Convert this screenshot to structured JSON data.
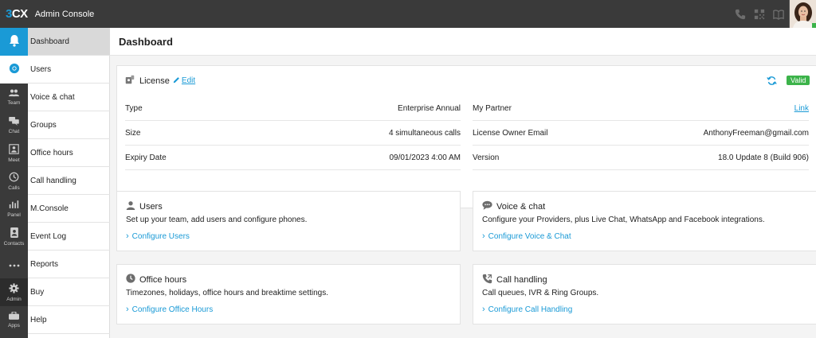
{
  "header": {
    "logo_three": "3",
    "logo_cx": "CX",
    "app_title": "Admin Console",
    "icons": [
      "phone-icon",
      "qr-code-icon",
      "book-icon"
    ]
  },
  "rail": {
    "items": [
      {
        "name": "notifications",
        "icon": "bell-icon",
        "label": ""
      },
      {
        "name": "chrome",
        "icon": "chrome-icon",
        "label": ""
      },
      {
        "name": "team",
        "icon": "team-icon",
        "label": "Team"
      },
      {
        "name": "chat",
        "icon": "chat-icon",
        "label": "Chat"
      },
      {
        "name": "meet",
        "icon": "meet-icon",
        "label": "Meet"
      },
      {
        "name": "calls",
        "icon": "calls-icon",
        "label": "Calls"
      },
      {
        "name": "panel",
        "icon": "panel-icon",
        "label": "Panel"
      },
      {
        "name": "contacts",
        "icon": "contacts-icon",
        "label": "Contacts"
      },
      {
        "name": "more",
        "icon": "more-icon",
        "label": ""
      },
      {
        "name": "admin",
        "icon": "gear-icon",
        "label": "Admin"
      },
      {
        "name": "apps",
        "icon": "apps-icon",
        "label": "Apps"
      }
    ]
  },
  "submenu": {
    "items": [
      {
        "label": "Dashboard",
        "active": true
      },
      {
        "label": "Users"
      },
      {
        "label": "Voice & chat"
      },
      {
        "label": "Groups"
      },
      {
        "label": "Office hours"
      },
      {
        "label": "Call handling"
      },
      {
        "label": "M.Console"
      },
      {
        "label": "Event Log"
      },
      {
        "label": "Reports"
      },
      {
        "label": "Buy"
      },
      {
        "label": "Help"
      }
    ]
  },
  "main": {
    "title": "Dashboard",
    "license": {
      "title": "License",
      "edit_label": "Edit",
      "status": "Valid",
      "status_color": "#3cb34a",
      "left_rows": [
        {
          "label": "Type",
          "value": "Enterprise Annual"
        },
        {
          "label": "Size",
          "value": "4 simultaneous calls"
        },
        {
          "label": "Expiry Date",
          "value": "09/01/2023 4:00 AM"
        }
      ],
      "right_rows": [
        {
          "label": "My Partner",
          "value": "Link"
        },
        {
          "label": "License Owner Email",
          "value": "AnthonyFreeman@gmail.com"
        },
        {
          "label": "Version",
          "value": "18.0 Update 8 (Build 906)"
        }
      ]
    },
    "tiles": [
      {
        "icon": "user-icon",
        "title": "Users",
        "desc": "Set up your team, add users and configure phones.",
        "link": "Configure Users"
      },
      {
        "icon": "chat-bubble-icon",
        "title": "Voice & chat",
        "desc": "Configure your Providers, plus Live Chat, WhatsApp and Facebook integrations.",
        "link": "Configure Voice & Chat"
      },
      {
        "icon": "clock-icon",
        "title": "Office hours",
        "desc": "Timezones, holidays, office hours and breaktime settings.",
        "link": "Configure Office Hours"
      },
      {
        "icon": "call-handling-icon",
        "title": "Call handling",
        "desc": "Call queues, IVR & Ring Groups.",
        "link": "Configure Call Handling"
      }
    ]
  },
  "colors": {
    "accent": "#1a9ad6",
    "topbar": "#3a3a3a",
    "valid": "#3cb34a"
  }
}
